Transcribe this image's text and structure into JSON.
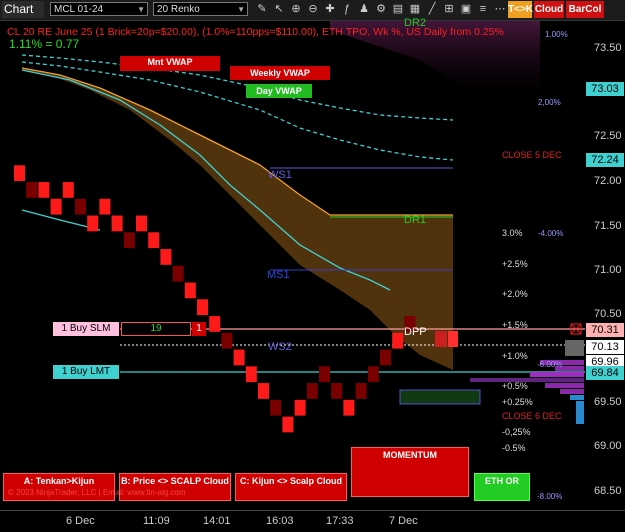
{
  "toolbar": {
    "title": "Chart",
    "symbol": "MCL 01-24",
    "bar_type": "20 Renko",
    "buttons": [
      {
        "label": "T<>K",
        "color": "#f0a020"
      },
      {
        "label": "Cloud",
        "color": "#d01010"
      },
      {
        "label": "BarCol",
        "color": "#d01010"
      }
    ]
  },
  "header": {
    "line1": "CL 20 RE June 25 (1 Brick=20p=$20.00), (1.0%=110pps=$110.00), ETH TPO, Wk %, US Daily from 0.25%",
    "line2": "1.11% = 0.77"
  },
  "levels": {
    "mnt_vwap": "Mnt VWAP",
    "weekly_vwap": "Weekly VWAP",
    "day_vwap": "Day VWAP",
    "dr2": "DR2",
    "dr1": "DR1",
    "ws1": "WS1",
    "ws2": "WS2",
    "ms1": "MS1",
    "dpp": "DPP",
    "close_5_dec": "CLOSE 5 DEC",
    "close_6_dec": "CLOSE 6 DEC"
  },
  "order_lines": {
    "buy_slm_label": "1 Buy SLM",
    "buy_slm_qty": "19",
    "buy_slm_count": "1",
    "buy_lmt_label": "1 Buy LMT"
  },
  "percent_labels": {
    "p1": "1.00%",
    "p2": "2,00%",
    "p4": "-4.00%",
    "p3": "3.0%",
    "p25": "+2.5%",
    "p20": "+2.0%",
    "p15": "+1.5%",
    "p10": "+1.0%",
    "p05": "+0.5%",
    "p025": "+0.25%",
    "m025": "-0,25%",
    "m05": "-0.5%",
    "m6": "-6.00%",
    "m8": "-8.00%"
  },
  "price_axis": {
    "labels": [
      "73.50",
      "73.00",
      "72.50",
      "72.00",
      "71.50",
      "71.00",
      "70.50",
      "70.00",
      "69.50",
      "69.00",
      "68.50"
    ],
    "tags": [
      {
        "value": "73.03",
        "color": "#40d0d0"
      },
      {
        "value": "72.24",
        "color": "#40d0d0"
      },
      {
        "value": "70.31",
        "color": "#ffb0b0"
      },
      {
        "value": "70.13",
        "color": "#ffffff"
      },
      {
        "value": "69.96",
        "color": "#ffffff"
      },
      {
        "value": "69.84",
        "color": "#40d0d0"
      }
    ]
  },
  "time_axis": [
    "6 Dec",
    "11:09",
    "14:01",
    "16:03",
    "17:33",
    "7 Dec"
  ],
  "bottom_buttons": {
    "tenkan": "A: Tenkan>Kijun",
    "price_scalp": "B: Price <> SCALP Cloud",
    "kijun_scalp": "C: Kijun <> Scalp Cloud",
    "momentum": "MOMENTUM",
    "eth_or": "ETH OR"
  },
  "watermark": "© 2023 NinjaTrader, LLC  |  Email: www.fin-alg.com",
  "colors": {
    "bear_brick": "#ff1a1a",
    "bear_brick_dark": "#7a0000",
    "cloud": "#6b4410",
    "cloud_edge": "#f0a030",
    "cyan": "#40d0d0",
    "accent_green": "#22cc22"
  },
  "chart_data": {
    "type": "renko",
    "brick_size": 0.2,
    "ylim": [
      68.4,
      73.7
    ],
    "bricks": [
      {
        "i": 0,
        "low": 72.1,
        "high": 72.3,
        "dir": "down"
      },
      {
        "i": 1,
        "low": 71.9,
        "high": 72.1,
        "dir": "down"
      },
      {
        "i": 2,
        "low": 71.9,
        "high": 72.1,
        "dir": "down"
      },
      {
        "i": 3,
        "low": 71.7,
        "high": 71.9,
        "dir": "down"
      },
      {
        "i": 4,
        "low": 71.9,
        "high": 72.1,
        "dir": "down"
      },
      {
        "i": 5,
        "low": 71.7,
        "high": 71.9,
        "dir": "down"
      },
      {
        "i": 6,
        "low": 71.5,
        "high": 71.7,
        "dir": "down"
      },
      {
        "i": 7,
        "low": 71.7,
        "high": 71.9,
        "dir": "down"
      },
      {
        "i": 8,
        "low": 71.5,
        "high": 71.7,
        "dir": "down"
      },
      {
        "i": 9,
        "low": 71.3,
        "high": 71.5,
        "dir": "down"
      },
      {
        "i": 10,
        "low": 71.5,
        "high": 71.7,
        "dir": "down"
      },
      {
        "i": 11,
        "low": 71.3,
        "high": 71.5,
        "dir": "down"
      },
      {
        "i": 12,
        "low": 71.1,
        "high": 71.3,
        "dir": "down"
      },
      {
        "i": 13,
        "low": 70.9,
        "high": 71.1,
        "dir": "down"
      },
      {
        "i": 14,
        "low": 70.7,
        "high": 70.9,
        "dir": "down"
      },
      {
        "i": 15,
        "low": 70.5,
        "high": 70.7,
        "dir": "down"
      },
      {
        "i": 16,
        "low": 70.3,
        "high": 70.5,
        "dir": "down"
      },
      {
        "i": 17,
        "low": 70.1,
        "high": 70.3,
        "dir": "down"
      },
      {
        "i": 18,
        "low": 69.9,
        "high": 70.1,
        "dir": "down"
      },
      {
        "i": 19,
        "low": 69.7,
        "high": 69.9,
        "dir": "down"
      },
      {
        "i": 20,
        "low": 69.5,
        "high": 69.7,
        "dir": "down"
      },
      {
        "i": 21,
        "low": 69.3,
        "high": 69.5,
        "dir": "down"
      },
      {
        "i": 22,
        "low": 69.1,
        "high": 69.3,
        "dir": "down"
      },
      {
        "i": 23,
        "low": 69.3,
        "high": 69.5,
        "dir": "down"
      },
      {
        "i": 24,
        "low": 69.5,
        "high": 69.7,
        "dir": "down"
      },
      {
        "i": 25,
        "low": 69.7,
        "high": 69.9,
        "dir": "down"
      },
      {
        "i": 26,
        "low": 69.5,
        "high": 69.7,
        "dir": "down"
      },
      {
        "i": 27,
        "low": 69.3,
        "high": 69.5,
        "dir": "down"
      },
      {
        "i": 28,
        "low": 69.5,
        "high": 69.7,
        "dir": "down"
      },
      {
        "i": 29,
        "low": 69.7,
        "high": 69.9,
        "dir": "down"
      },
      {
        "i": 30,
        "low": 69.9,
        "high": 70.1,
        "dir": "down"
      },
      {
        "i": 31,
        "low": 70.1,
        "high": 70.3,
        "dir": "down"
      },
      {
        "i": 32,
        "low": 70.3,
        "high": 70.5,
        "dir": "down"
      }
    ]
  }
}
